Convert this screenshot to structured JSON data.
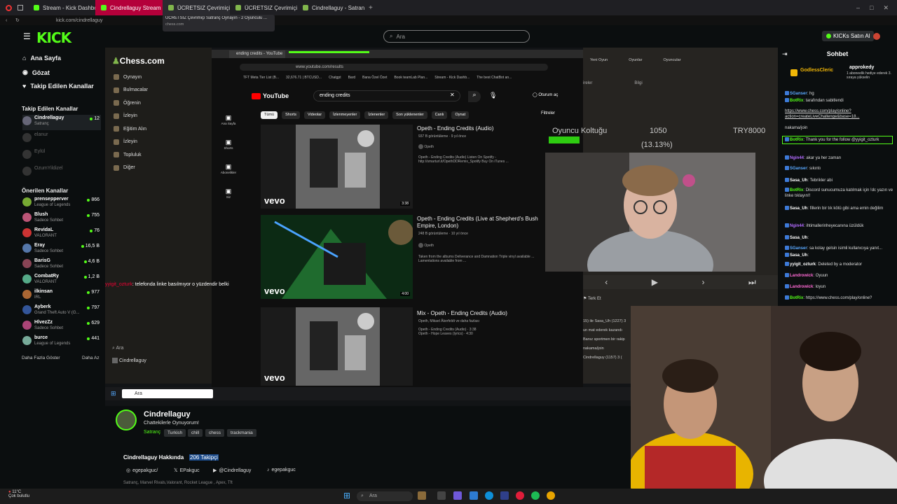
{
  "browser": {
    "tabs": [
      {
        "label": "Stream - Kick Dashboard",
        "color": "#53fc18"
      },
      {
        "label": "Cindrellaguy Stream",
        "color": "#53fc18"
      },
      {
        "label": "ÜCRETSIZ Çevrimiçi Sa",
        "color": "#81b64c"
      },
      {
        "label": "ÜCRETSIZ Çevrimiçi Satra",
        "color": "#81b64c"
      },
      {
        "label": "Cindrellaguy - Satranç Pro",
        "color": "#81b64c"
      }
    ],
    "tooltip_title": "ÜCRETSIZ Çevrimiçi Satranç Oynayın - 2 Oyunculu ...",
    "tooltip_domain": "chess.com",
    "url": "kick.com/cindrellaguy"
  },
  "header": {
    "search_placeholder": "Ara",
    "buy_kicks": "KICKs Satın Al",
    "brand_color": "#53fc18"
  },
  "sidebar": {
    "nav": [
      {
        "label": "Ana Sayfa",
        "icon": "home-icon"
      },
      {
        "label": "Gözat",
        "icon": "browse-icon"
      },
      {
        "label": "Takip Edilen Kanallar",
        "icon": "heart-icon"
      }
    ],
    "followed_title": "Takip Edilen Kanallar",
    "followed": [
      {
        "name": "Cindrellaguy",
        "sub": "Satranç",
        "count": "12",
        "live": true
      },
      {
        "name": "elanur",
        "sub": "",
        "count": "",
        "live": false
      },
      {
        "name": "Eylül",
        "sub": "",
        "count": "",
        "live": false
      },
      {
        "name": "OzumYildizel",
        "sub": "",
        "count": "",
        "live": false
      }
    ],
    "recommended_title": "Önerilen Kanallar",
    "recommended": [
      {
        "name": "prensepperver",
        "sub": "League of Legends",
        "count": "866"
      },
      {
        "name": "Blush",
        "sub": "Sadece Sohbet",
        "count": "755"
      },
      {
        "name": "RevidaL",
        "sub": "VALORANT",
        "count": "76"
      },
      {
        "name": "Eray",
        "sub": "Sadece Sohbet",
        "count": "16,5 B"
      },
      {
        "name": "BarisG",
        "sub": "Sadece Sohbet",
        "count": "4,6 B"
      },
      {
        "name": "CombatRy",
        "sub": "VALORANT",
        "count": "1,2 B"
      },
      {
        "name": "ilkinsan",
        "sub": "IRL",
        "count": "977"
      },
      {
        "name": "Ayberk",
        "sub": "Grand Theft Auto V (G...",
        "count": "797"
      },
      {
        "name": "HlvezZz",
        "sub": "Sadece Sohbet",
        "count": "629"
      },
      {
        "name": "burce",
        "sub": "League of Legends",
        "count": "441"
      }
    ],
    "show_more": "Daha Fazla Göster",
    "show_less": "Daha Az"
  },
  "video": {
    "chess": {
      "logo": "Chess.com",
      "nav": [
        "Oynayın",
        "Bulmacalar",
        "Öğrenin",
        "İzleyin",
        "Eğitim Alın",
        "İzleyin",
        "Topluluk",
        "Diğer"
      ],
      "search": "Ara",
      "user": "Cindrellaguy",
      "right_tabs": [
        "Yeni Oyun",
        "Oyunlar",
        "Oyuncular"
      ],
      "right_sub": [
        "ireler",
        "Bilgi"
      ],
      "player_label": "Oyuncu Koltuğu",
      "score": "1050",
      "percent": "(13.13%)",
      "currency": "TRY8000",
      "resign": "Terk Et",
      "log": [
        "15) ile Sasa_Uh (1227) 3",
        "un mat ederek kazandı",
        "Banız sportmen bir rakip",
        "nakama/join",
        "Cindrellaguy (1157) 3 ("
      ]
    },
    "overlay_text": ": telefonda linke basılmıyor o yüzdendir belki",
    "overlay_user": "yyigit_ozturk",
    "youtube": {
      "tab": "ending credits - YouTube",
      "url": "www.youtube.com/results",
      "bookmarks": [
        "TFT Meta Tier List (B...",
        "32,676.71 | BTCUSD...",
        "Chatgpt",
        "Bard",
        "Bana Özel Özet",
        "Book teamLab Plan...",
        "Stream - Kick Dashb...",
        "The best ChatBot an..."
      ],
      "logo": "YouTube",
      "query": "ending credits",
      "sign_in": "Oturum aç",
      "filters": "Filtreler",
      "chips": [
        "Tümü",
        "Shorts",
        "Videolar",
        "İzlenmeyenler",
        "İzlenenler",
        "Son yüklenenler",
        "Canlı",
        "Oynat"
      ],
      "left_nav": [
        "Ana Sayfa",
        "Shorts",
        "Abonelikler",
        "Siz"
      ],
      "results": [
        {
          "title": "Opeth - Ending Credits (Audio)",
          "meta": "937 B görüntüleme · 9 yıl önce",
          "channel": "Opeth",
          "desc": "Opeth - Ending Credits (Audio) Listen On Spotify - http://smarturl.it/OpethDDRemix_Spotify Buy On iTunes ...",
          "duration": "3:38",
          "vevo": "vevo"
        },
        {
          "title": "Opeth - Ending Credits (Live at Shepherd's Bush Empire, London)",
          "meta": "248 B görüntüleme · 10 yıl önce",
          "channel": "Opeth",
          "desc": "Taken from the albums Deliverance and Damnation Triple vinyl available ... Lamentations available from ...",
          "duration": "4:00",
          "vevo": "vevo"
        },
        {
          "title": "Mix - Opeth - Ending Credits (Audio)",
          "meta": "Opeth, Mikael Åkerfeldt ve daha fazlası",
          "channel": "",
          "desc": "Opeth - Ending Credits (Audio) · 3:38\nOpeth - Hope Leaves (lyrics) · 4:30",
          "duration": "",
          "vevo": "vevo"
        }
      ]
    },
    "taskbar_search": "Ara"
  },
  "chat": {
    "title": "Sohbet",
    "pinned_user": "GodlessCleric",
    "pinned_text": "1 aboneelik hediye ederek 3. sıraya yükselin",
    "top_user": "approkedy",
    "messages": [
      {
        "user": "SGanser",
        "text": "hg",
        "color": "#5aa9ff"
      },
      {
        "user": "BotRix",
        "text": "tarafından sabitlendi",
        "color": "#53fc18"
      },
      {
        "user": "",
        "text": "https://www.chess.com/play/online?action=createLiveChallenge&base=18...",
        "color": "#ffffff"
      },
      {
        "user": "",
        "text": "nakama/join",
        "color": "#ffffff"
      },
      {
        "user": "BotRix",
        "text": "Thank you for the follow @yyigit_ozturk",
        "color": "#53fc18"
      },
      {
        "user": "Ngin44",
        "text": "akar ya her zaman",
        "color": "#b36bff"
      },
      {
        "user": "SGanser",
        "text": "sıkıntı",
        "color": "#5aa9ff"
      },
      {
        "user": "Sasa_Uh",
        "text": "Tebrikler abi",
        "color": "#ffffff"
      },
      {
        "user": "BotRix",
        "text": "Discord sunucumuza katılmak için !dc yazın ve linke tıklayın!!",
        "color": "#53fc18"
      },
      {
        "user": "Sasa_Uh",
        "text": "fillerin bir tık kötü gibi ama emin değilim",
        "color": "#ffffff"
      },
      {
        "user": "Ngin44",
        "text": "ihtimallerinheyecanına üzüldük",
        "color": "#b36bff"
      },
      {
        "user": "Sasa_Uh",
        "text": "",
        "color": "#ffffff"
      },
      {
        "user": "SGanser",
        "text": "sa kolay gelsin isimli kullanıcıya yanıt...",
        "color": "#5aa9ff"
      },
      {
        "user": "Sasa_Uh",
        "text": "",
        "color": "#ffffff"
      },
      {
        "user": "yyigit_ozturk",
        "text": "Deleted by a moderator",
        "color": "#ffffff"
      },
      {
        "user": "Landrowick",
        "text": "Oyuun",
        "color": "#ff6ad5"
      },
      {
        "user": "Landrowick",
        "text": "loyun",
        "color": "#ff6ad5"
      },
      {
        "user": "BotRix",
        "text": "https://www.chess.com/play/online?",
        "color": "#53fc18"
      }
    ]
  },
  "channel": {
    "name": "Cindrellaguy",
    "title": "Chattekilerle Oynuyorum!",
    "category": "Satranç",
    "tags": [
      "Turkish",
      "chill",
      "chess",
      "trackmania"
    ],
    "about": "Cindrellaguy Hakkında",
    "followers": "206 Takipçi",
    "socials": [
      {
        "icon": "instagram-icon",
        "label": "egepakguc/"
      },
      {
        "icon": "x-icon",
        "label": "EPakguc"
      },
      {
        "icon": "youtube-icon",
        "label": "@Cindrellaguy"
      },
      {
        "icon": "tiktok-icon",
        "label": "egepakguc"
      }
    ],
    "games": "Satranç, Marvel Rivals,Valorant, Rocket League , Apex, Tft"
  },
  "windows": {
    "search": "Ara",
    "weather_temp": "11°C",
    "weather_text": "Çok bulutlu"
  }
}
